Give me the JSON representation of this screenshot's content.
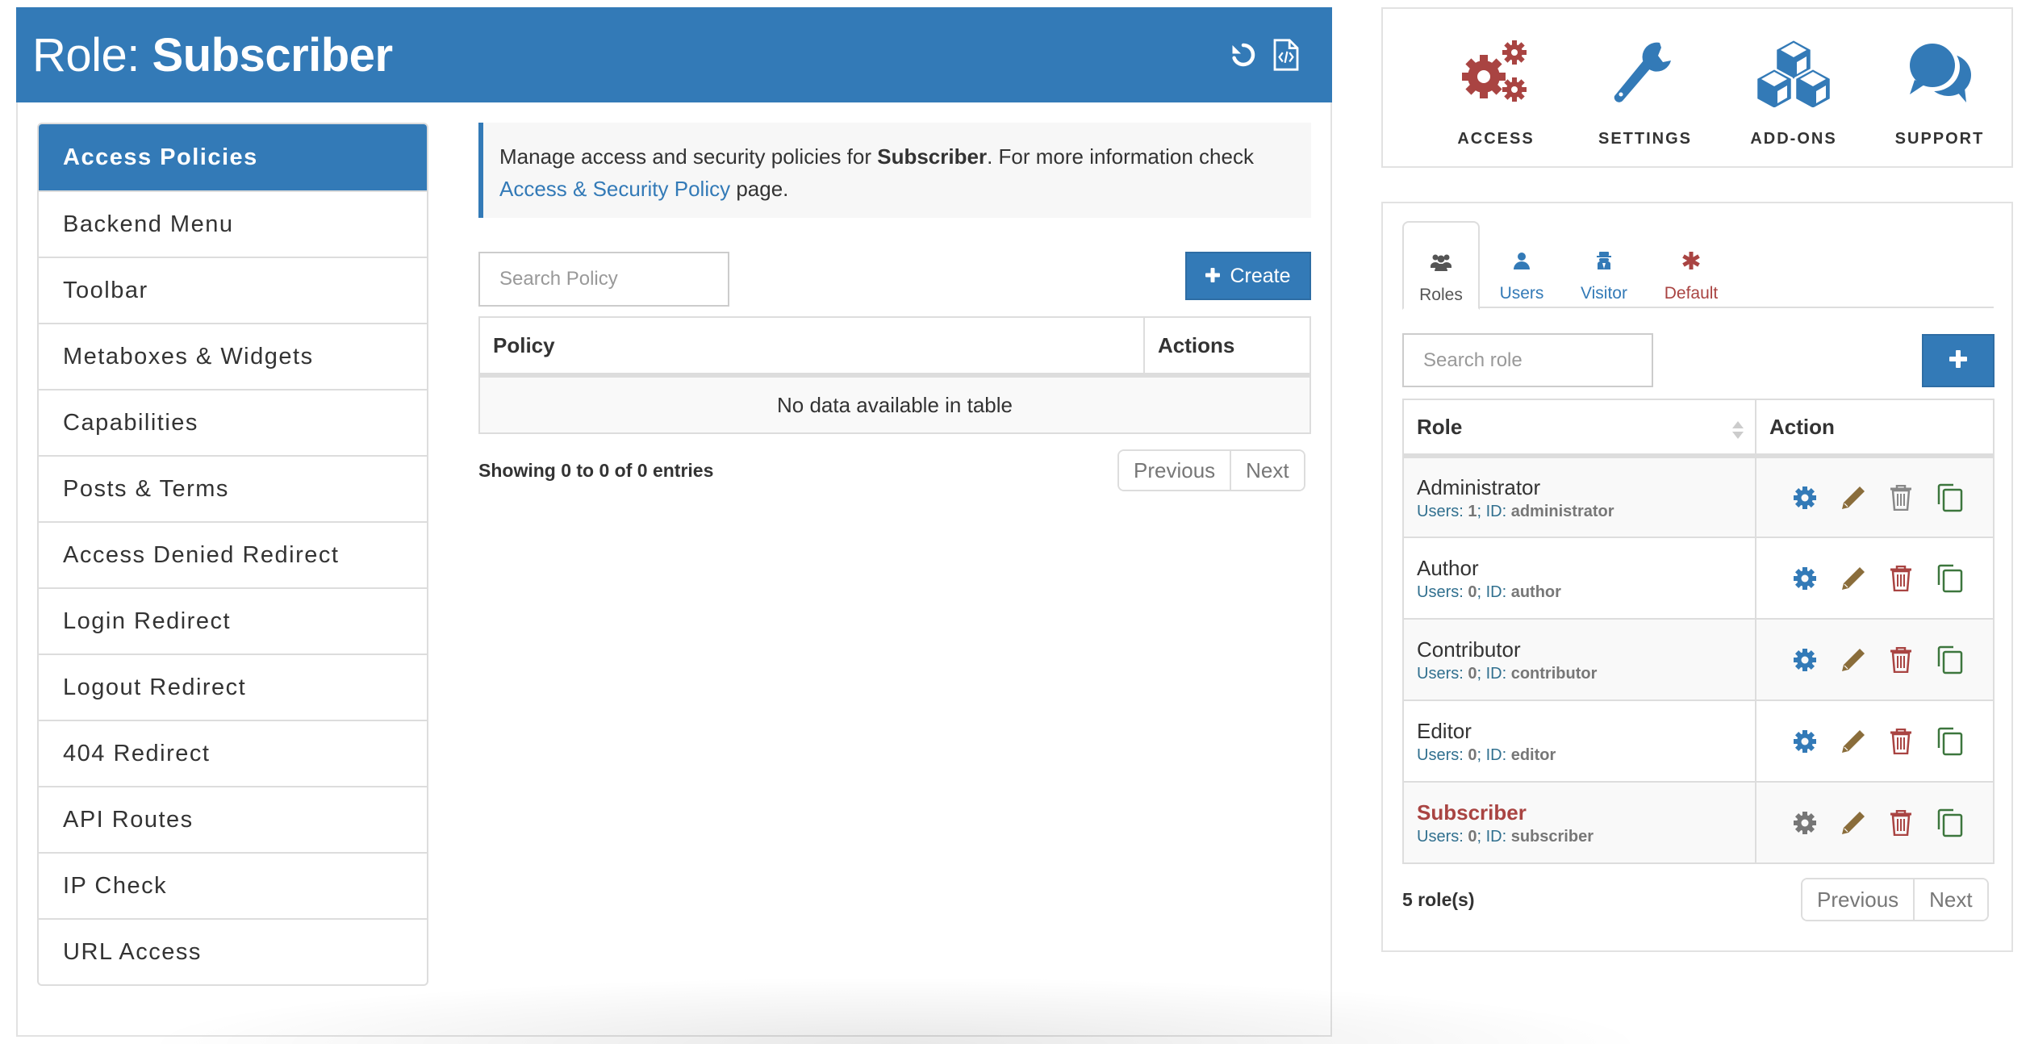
{
  "header": {
    "title_prefix": "Role: ",
    "title_role": "Subscriber",
    "icons": [
      "reset-icon",
      "export-code-icon"
    ]
  },
  "sidebar": {
    "items": [
      {
        "label": "Access Policies",
        "active": true
      },
      {
        "label": "Backend Menu"
      },
      {
        "label": "Toolbar"
      },
      {
        "label": "Metaboxes & Widgets"
      },
      {
        "label": "Capabilities"
      },
      {
        "label": "Posts & Terms"
      },
      {
        "label": "Access Denied Redirect"
      },
      {
        "label": "Login Redirect"
      },
      {
        "label": "Logout Redirect"
      },
      {
        "label": "404 Redirect"
      },
      {
        "label": "API Routes"
      },
      {
        "label": "IP Check"
      },
      {
        "label": "URL Access"
      }
    ]
  },
  "main": {
    "info": {
      "text_before": "Manage access and security policies for ",
      "role": "Subscriber",
      "text_after": ". For more information check ",
      "link": "Access & Security Policy",
      "text_end": " page."
    },
    "search": {
      "placeholder": "Search Policy",
      "value": ""
    },
    "create_label": "Create",
    "table": {
      "columns": [
        "Policy",
        "Actions"
      ],
      "rows": [],
      "empty_text": "No data available in table"
    },
    "showing": "Showing 0 to 0 of 0 entries",
    "pagination": {
      "previous": "Previous",
      "next": "Next"
    }
  },
  "nav": {
    "items": [
      {
        "label": "ACCESS",
        "icon": "cogs-icon",
        "color": "#a94442"
      },
      {
        "label": "SETTINGS",
        "icon": "wrench-icon",
        "color": "#337ab7"
      },
      {
        "label": "ADD-ONS",
        "icon": "cubes-icon",
        "color": "#337ab7"
      },
      {
        "label": "SUPPORT",
        "icon": "chat-icon",
        "color": "#337ab7"
      }
    ]
  },
  "roles_panel": {
    "tabs": [
      {
        "label": "Roles",
        "icon": "users-group-icon",
        "active": true,
        "color": "#555555"
      },
      {
        "label": "Users",
        "icon": "user-icon",
        "color": "#337ab7"
      },
      {
        "label": "Visitor",
        "icon": "visitor-spy-icon",
        "color": "#337ab7"
      },
      {
        "label": "Default",
        "icon": "asterisk-icon",
        "color": "#a94442"
      }
    ],
    "search": {
      "placeholder": "Search role",
      "value": ""
    },
    "add_label": "+",
    "columns": [
      "Role",
      "Action"
    ],
    "users_label": "Users: ",
    "id_label": "ID: ",
    "rows": [
      {
        "name": "Administrator",
        "users": "1",
        "id": "administrator",
        "current": false,
        "delete_enabled": false
      },
      {
        "name": "Author",
        "users": "0",
        "id": "author",
        "current": false,
        "delete_enabled": true
      },
      {
        "name": "Contributor",
        "users": "0",
        "id": "contributor",
        "current": false,
        "delete_enabled": true
      },
      {
        "name": "Editor",
        "users": "0",
        "id": "editor",
        "current": false,
        "delete_enabled": true
      },
      {
        "name": "Subscriber",
        "users": "0",
        "id": "subscriber",
        "current": true,
        "delete_enabled": true
      }
    ],
    "count": "5 role(s)",
    "pagination": {
      "previous": "Previous",
      "next": "Next"
    }
  },
  "colors": {
    "primary": "#337ab7",
    "danger": "#a94442",
    "edit": "#8a6d3b",
    "clone": "#3c763d",
    "muted": "#777777",
    "info": "#31708f"
  }
}
